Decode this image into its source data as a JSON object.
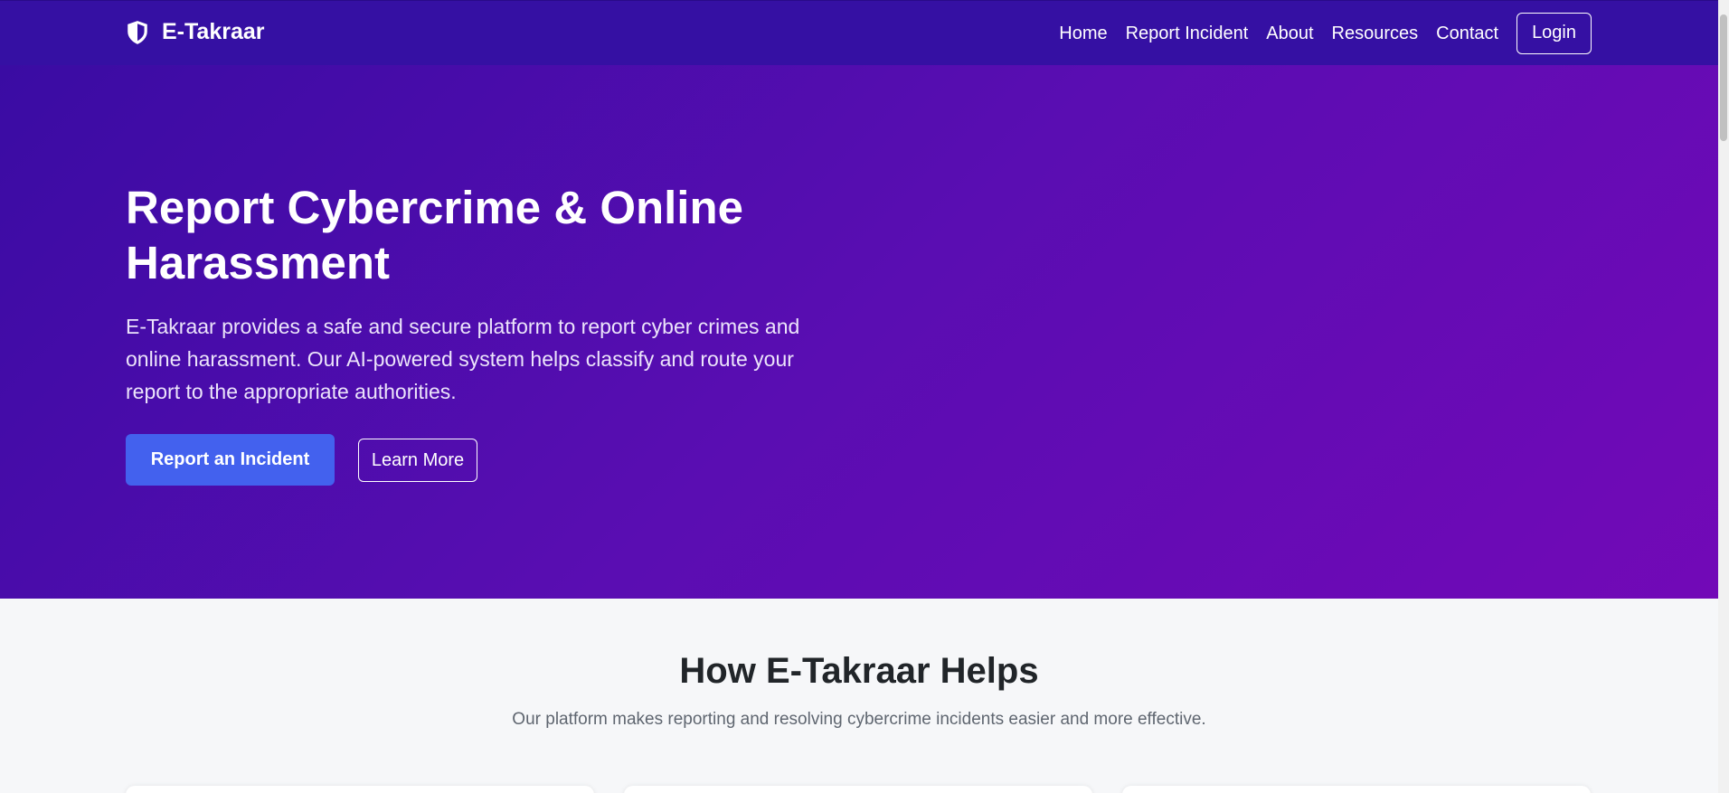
{
  "navbar": {
    "brand": "E-Takraar",
    "links": [
      "Home",
      "Report Incident",
      "About",
      "Resources",
      "Contact"
    ],
    "login": "Login"
  },
  "hero": {
    "title": "Report Cybercrime & Online Harassment",
    "text": "E-Takraar provides a safe and secure platform to report cyber crimes and online harassment. Our AI-powered system helps classify and route your report to the appropriate authorities.",
    "primary_button": "Report an Incident",
    "secondary_button": "Learn More"
  },
  "features": {
    "title": "How E-Takraar Helps",
    "subtitle": "Our platform makes reporting and resolving cybercrime incidents easier and more effective."
  },
  "colors": {
    "navbar": "#3510a3",
    "hero_start": "#3a0ca3",
    "hero_end": "#7209b7",
    "primary": "#4361ee"
  },
  "icons": {
    "brand": "shield-icon"
  }
}
